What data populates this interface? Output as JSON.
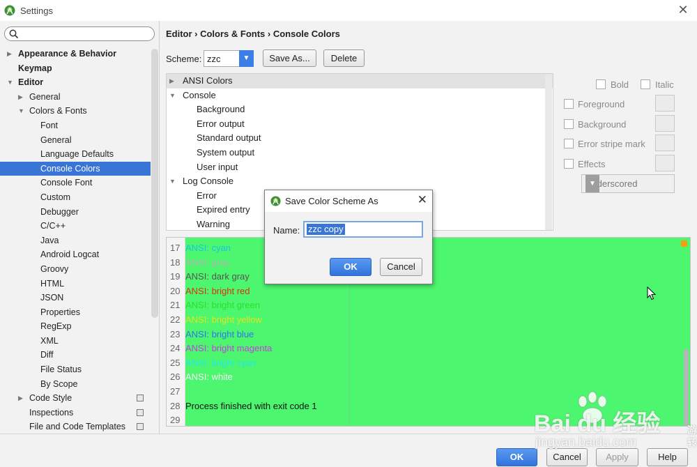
{
  "window": {
    "title": "Settings"
  },
  "search": {
    "placeholder": ""
  },
  "sidebar": {
    "items": [
      {
        "label": "Appearance & Behavior",
        "level": 0,
        "arrow": "▶",
        "bold": true,
        "selected": false,
        "gear": false
      },
      {
        "label": "Keymap",
        "level": 0,
        "arrow": "",
        "bold": true,
        "selected": false,
        "gear": false
      },
      {
        "label": "Editor",
        "level": 0,
        "arrow": "▼",
        "bold": true,
        "selected": false,
        "gear": false
      },
      {
        "label": "General",
        "level": 1,
        "arrow": "▶",
        "bold": false,
        "selected": false,
        "gear": false
      },
      {
        "label": "Colors & Fonts",
        "level": 1,
        "arrow": "▼",
        "bold": false,
        "selected": false,
        "gear": false
      },
      {
        "label": "Font",
        "level": 2,
        "arrow": "",
        "bold": false,
        "selected": false,
        "gear": false
      },
      {
        "label": "General",
        "level": 2,
        "arrow": "",
        "bold": false,
        "selected": false,
        "gear": false
      },
      {
        "label": "Language Defaults",
        "level": 2,
        "arrow": "",
        "bold": false,
        "selected": false,
        "gear": false
      },
      {
        "label": "Console Colors",
        "level": 2,
        "arrow": "",
        "bold": false,
        "selected": true,
        "gear": false
      },
      {
        "label": "Console Font",
        "level": 2,
        "arrow": "",
        "bold": false,
        "selected": false,
        "gear": false
      },
      {
        "label": "Custom",
        "level": 2,
        "arrow": "",
        "bold": false,
        "selected": false,
        "gear": false
      },
      {
        "label": "Debugger",
        "level": 2,
        "arrow": "",
        "bold": false,
        "selected": false,
        "gear": false
      },
      {
        "label": "C/C++",
        "level": 2,
        "arrow": "",
        "bold": false,
        "selected": false,
        "gear": false
      },
      {
        "label": "Java",
        "level": 2,
        "arrow": "",
        "bold": false,
        "selected": false,
        "gear": false
      },
      {
        "label": "Android Logcat",
        "level": 2,
        "arrow": "",
        "bold": false,
        "selected": false,
        "gear": false
      },
      {
        "label": "Groovy",
        "level": 2,
        "arrow": "",
        "bold": false,
        "selected": false,
        "gear": false
      },
      {
        "label": "HTML",
        "level": 2,
        "arrow": "",
        "bold": false,
        "selected": false,
        "gear": false
      },
      {
        "label": "JSON",
        "level": 2,
        "arrow": "",
        "bold": false,
        "selected": false,
        "gear": false
      },
      {
        "label": "Properties",
        "level": 2,
        "arrow": "",
        "bold": false,
        "selected": false,
        "gear": false
      },
      {
        "label": "RegExp",
        "level": 2,
        "arrow": "",
        "bold": false,
        "selected": false,
        "gear": false
      },
      {
        "label": "XML",
        "level": 2,
        "arrow": "",
        "bold": false,
        "selected": false,
        "gear": false
      },
      {
        "label": "Diff",
        "level": 2,
        "arrow": "",
        "bold": false,
        "selected": false,
        "gear": false
      },
      {
        "label": "File Status",
        "level": 2,
        "arrow": "",
        "bold": false,
        "selected": false,
        "gear": false
      },
      {
        "label": "By Scope",
        "level": 2,
        "arrow": "",
        "bold": false,
        "selected": false,
        "gear": false
      },
      {
        "label": "Code Style",
        "level": 1,
        "arrow": "▶",
        "bold": false,
        "selected": false,
        "gear": true
      },
      {
        "label": "Inspections",
        "level": 1,
        "arrow": "",
        "bold": false,
        "selected": false,
        "gear": true
      },
      {
        "label": "File and Code Templates",
        "level": 1,
        "arrow": "",
        "bold": false,
        "selected": false,
        "gear": true
      }
    ]
  },
  "header": {
    "breadcrumb": "Editor › Colors & Fonts › Console Colors"
  },
  "scheme": {
    "label": "Scheme:",
    "value": "zzc",
    "save_as_label": "Save As...",
    "delete_label": "Delete"
  },
  "elements": [
    {
      "label": "ANSI Colors",
      "level": 0,
      "arrow": "▶",
      "highlighted": true
    },
    {
      "label": "Console",
      "level": 0,
      "arrow": "▼",
      "highlighted": false
    },
    {
      "label": "Background",
      "level": 1,
      "arrow": "",
      "highlighted": false
    },
    {
      "label": "Error output",
      "level": 1,
      "arrow": "",
      "highlighted": false
    },
    {
      "label": "Standard output",
      "level": 1,
      "arrow": "",
      "highlighted": false
    },
    {
      "label": "System output",
      "level": 1,
      "arrow": "",
      "highlighted": false
    },
    {
      "label": "User input",
      "level": 1,
      "arrow": "",
      "highlighted": false
    },
    {
      "label": "Log Console",
      "level": 0,
      "arrow": "▼",
      "highlighted": false
    },
    {
      "label": "Error",
      "level": 1,
      "arrow": "",
      "highlighted": false
    },
    {
      "label": "Expired entry",
      "level": 1,
      "arrow": "",
      "highlighted": false
    },
    {
      "label": "Warning",
      "level": 1,
      "arrow": "",
      "highlighted": false
    }
  ],
  "attributes": {
    "bold_label": "Bold",
    "italic_label": "Italic",
    "foreground_label": "Foreground",
    "background_label": "Background",
    "error_stripe_label": "Error stripe mark",
    "effects_label": "Effects",
    "effect_type": "Underscored"
  },
  "preview": {
    "background": "#4cf66e",
    "lines": [
      {
        "num": "17",
        "text": "ANSI: cyan",
        "color": "#19c4e8"
      },
      {
        "num": "18",
        "text": "ANSI: gray",
        "color": "#b3b3b3"
      },
      {
        "num": "19",
        "text": "ANSI: dark gray",
        "color": "#555555"
      },
      {
        "num": "20",
        "text": "ANSI: bright red",
        "color": "#e0300c"
      },
      {
        "num": "21",
        "text": "ANSI: bright green",
        "color": "#2ae02a"
      },
      {
        "num": "22",
        "text": "ANSI: bright yellow",
        "color": "#e6e21a"
      },
      {
        "num": "23",
        "text": "ANSI: bright blue",
        "color": "#2d76f0"
      },
      {
        "num": "24",
        "text": "ANSI: bright magenta",
        "color": "#c83ee0"
      },
      {
        "num": "25",
        "text": "ANSI: bright cyan",
        "color": "#22e8e8"
      },
      {
        "num": "26",
        "text": "ANSI: white",
        "color": "#f5f5f5"
      },
      {
        "num": "27",
        "text": "",
        "color": "#111111"
      },
      {
        "num": "28",
        "text": "Process finished with exit code 1",
        "color": "#111111"
      },
      {
        "num": "29",
        "text": "",
        "color": "#111111"
      }
    ]
  },
  "dialog": {
    "title": "Save Color Scheme As",
    "name_label": "Name:",
    "name_value": "zzc copy",
    "ok_label": "OK",
    "cancel_label": "Cancel"
  },
  "footer": {
    "ok_label": "OK",
    "cancel_label": "Cancel",
    "apply_label": "Apply",
    "help_label": "Help"
  },
  "watermark": {
    "logo_text": "Bai du 经验",
    "url_text": "jingyan.baidu.com",
    "side_text": "游 转"
  }
}
